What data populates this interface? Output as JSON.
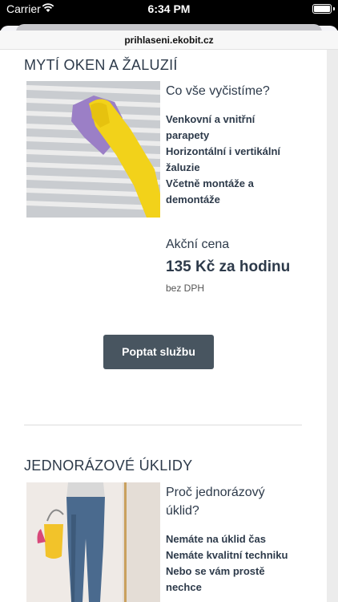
{
  "status_bar": {
    "carrier": "Carrier",
    "time": "6:34 PM"
  },
  "browser": {
    "url": "prihlaseni.ekobit.cz"
  },
  "sections": [
    {
      "title": "MYTÍ OKEN A ŽALUZIÍ",
      "question": "Co vše vyčistíme?",
      "features": [
        "Venkovní a vnitřní parapety",
        "Horizontální i vertikální žaluzie",
        "Včetně montáže a demontáže"
      ],
      "price_label": "Akční cena",
      "price": "135 Kč za hodinu",
      "price_note": "bez DPH",
      "button": "Poptat službu"
    },
    {
      "title": "JEDNORÁZOVÉ ÚKLIDY",
      "question": "Proč jednorázový úklid?",
      "features": [
        "Nemáte na úklid čas",
        "Nemáte kvalitní techniku",
        "Nebo se vám prostě nechce"
      ]
    }
  ]
}
